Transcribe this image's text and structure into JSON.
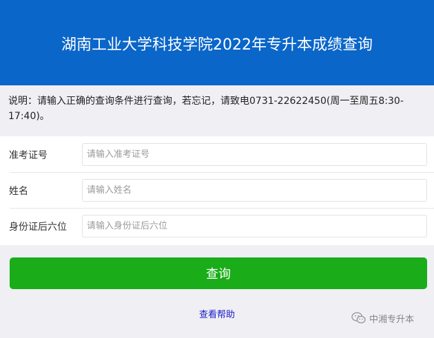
{
  "header": {
    "title": "湖南工业大学科技学院2022年专升本成绩查询",
    "bg_color": "#0a66c9"
  },
  "notice": {
    "text": "说明：请输入正确的查询条件进行查询，若忘记，请致电0731-22622450(周一至周五8:30-17:40)。"
  },
  "form": {
    "fields": [
      {
        "label": "准考证号",
        "placeholder": "请输入准考证号",
        "value": ""
      },
      {
        "label": "姓名",
        "placeholder": "请输入姓名",
        "value": ""
      },
      {
        "label": "身份证后六位",
        "placeholder": "请输入身份证后六位",
        "value": ""
      }
    ]
  },
  "actions": {
    "submit_label": "查询",
    "submit_color": "#1aad19",
    "help_label": "查看帮助"
  },
  "watermark": {
    "text": "中湘专升本",
    "icon": "wechat-icon"
  }
}
